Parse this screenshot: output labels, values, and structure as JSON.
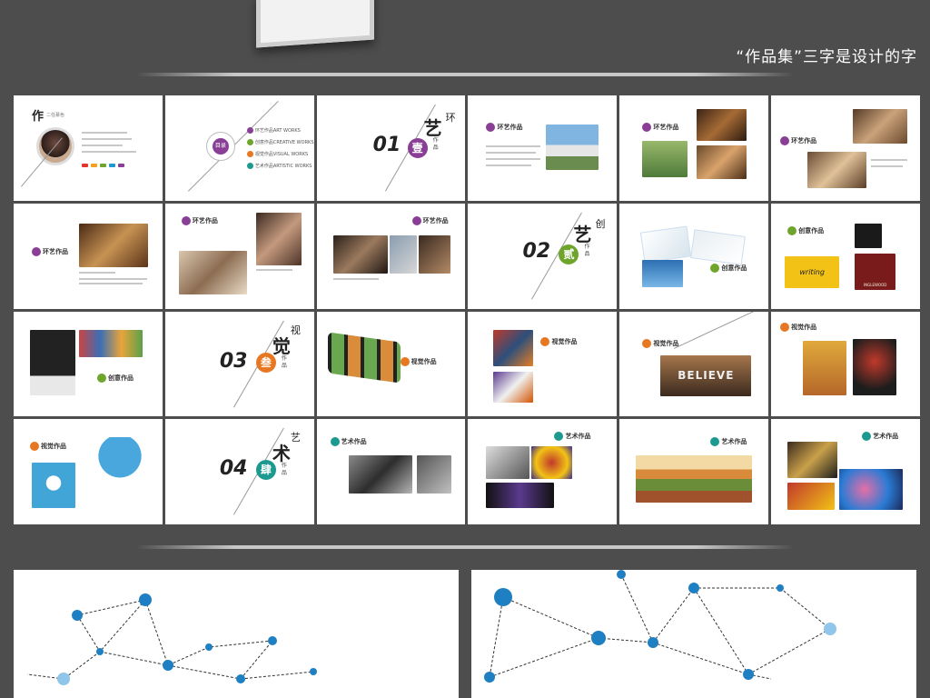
{
  "caption": "“作品集”三字是设计的字",
  "section_titles": [
    {
      "num": "01",
      "seal": "壹",
      "kanji": "艺",
      "kanji2": "环",
      "sub": "作品",
      "color": "#8a3f96"
    },
    {
      "num": "02",
      "seal": "贰",
      "kanji": "艺",
      "kanji2": "创",
      "sub": "作品",
      "color": "#6fa52c"
    },
    {
      "num": "03",
      "seal": "叁",
      "kanji": "觉",
      "kanji2": "视",
      "sub": "作品",
      "color": "#e87722"
    },
    {
      "num": "04",
      "seal": "肆",
      "kanji": "术",
      "kanji2": "艺",
      "sub": "作品",
      "color": "#1d9a8f"
    }
  ],
  "labels": {
    "env": "环艺作品",
    "create": "创意作品",
    "visual": "视觉作品",
    "art": "艺术作品",
    "toc": "目录",
    "profile": "作",
    "profile_name": "二任慕色"
  },
  "toc_items": [
    {
      "text": "环艺作品ART WORKS",
      "color": "#8a3f96"
    },
    {
      "text": "创意作品CREATIVE WORKS",
      "color": "#6fa52c"
    },
    {
      "text": "视觉作品VISUAL WORKS",
      "color": "#e87722"
    },
    {
      "text": "艺术作品ARTISTIC WORKS",
      "color": "#1d9a8f"
    }
  ],
  "photo_words": {
    "believe": "BELIEVE",
    "sign": "INGLEWOOD",
    "writing": "writing"
  }
}
